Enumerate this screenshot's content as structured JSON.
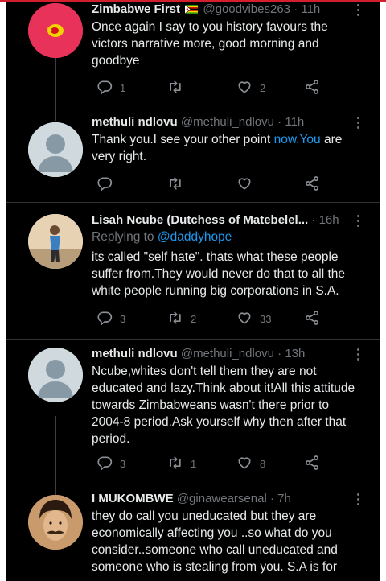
{
  "tweets": [
    {
      "name": "Zimbabwe First",
      "handle": "@goodvibes263",
      "time": "· 11h",
      "text": "Once again I say to you history favours the victors narrative more, good morning and goodbye",
      "replies": "1",
      "retweets": "",
      "likes": "2"
    },
    {
      "name": "methuli ndlovu",
      "handle": "@methuli_ndlovu",
      "time": "· 11h",
      "text_before": "Thank you.I see your other point ",
      "text_link": "now.You",
      "text_after": " are very right.",
      "replies": "",
      "retweets": "",
      "likes": ""
    },
    {
      "name": "Lisah Ncube (Dutchess of Matebelel...",
      "handle": "",
      "time": "· 16h",
      "replying_label": "Replying to",
      "replying_to": "@daddyhope",
      "text": "its called \"self hate\". thats what these people suffer from.They would never do that to all the white people running big corporations in S.A.",
      "replies": "3",
      "retweets": "2",
      "likes": "33"
    },
    {
      "name": "methuli ndlovu",
      "handle": "@methuli_ndlovu",
      "time": "· 13h",
      "text": "Ncube,whites don't tell them they are not educated and lazy.Think about it!All this attitude towards Zimbabweans wasn't there prior to 2004-8 period.Ask yourself why then after that period.",
      "replies": "3",
      "retweets": "1",
      "likes": "8"
    },
    {
      "name": "I MUKOMBWE",
      "handle": "@ginawearsenal",
      "time": "· 7h",
      "text": "they do call you uneducated but they are economically affecting you ..so what do you consider..someone who call uneducated and someone who is stealing from you. S.A is for"
    }
  ],
  "icons": {
    "reply": "reply-icon",
    "retweet": "retweet-icon",
    "like": "heart-icon",
    "share": "share-icon",
    "more": "more-icon",
    "flag": "zimbabwe-flag-icon"
  },
  "colors": {
    "background": "#000000",
    "text": "#e7e9ea",
    "muted": "#71767b",
    "link": "#1d9bf0"
  }
}
